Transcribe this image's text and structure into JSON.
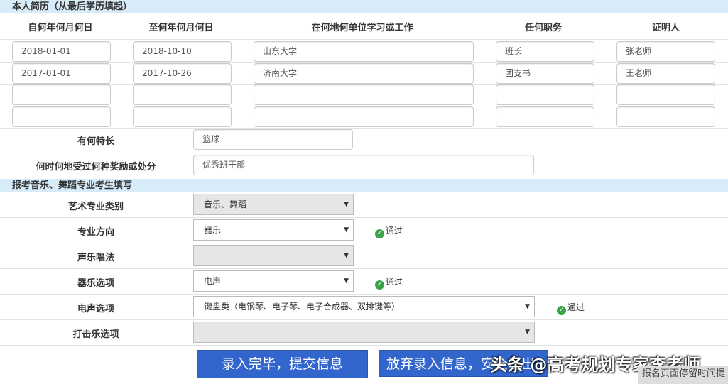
{
  "resume": {
    "title": "本人简历（从最后学历填起）",
    "columns": [
      "自何年何月何日",
      "至何年何月何日",
      "在何地何单位学习或工作",
      "任何职务",
      "证明人"
    ],
    "rows": [
      [
        "2018-01-01",
        "2018-10-10",
        "山东大学",
        "班长",
        "张老师"
      ],
      [
        "2017-01-01",
        "2017-10-26",
        "济南大学",
        "团支书",
        "王老师"
      ],
      [
        "",
        "",
        "",
        "",
        ""
      ],
      [
        "",
        "",
        "",
        "",
        ""
      ]
    ],
    "specialty_label": "有何特长",
    "specialty": "篮球",
    "awards_label": "何时何地受过何种奖励或处分",
    "awards": "优秀班干部"
  },
  "art": {
    "title": "报考音乐、舞蹈专业考生填写",
    "fields": [
      {
        "label": "艺术专业类别",
        "value": "音乐、舞蹈",
        "status": ""
      },
      {
        "label": "专业方向",
        "value": "器乐",
        "status": "通过"
      },
      {
        "label": "声乐唱法",
        "value": "",
        "status": ""
      },
      {
        "label": "器乐选项",
        "value": "电声",
        "status": "通过"
      },
      {
        "label": "电声选项",
        "value": "键盘类（电钢琴、电子琴、电子合成器、双排键等）",
        "status": "通过"
      },
      {
        "label": "打击乐选项",
        "value": "",
        "status": ""
      }
    ]
  },
  "buttons": {
    "submit": "录入完毕，提交信息",
    "cancel": "放弃录入信息，安全退出"
  },
  "watermark": {
    "text": "头条 @高考规划专家李老师",
    "overlay": "报名页面停留时间提"
  },
  "colors": {
    "section_bg": "#d7ebf9",
    "button": "#3366cc",
    "ok": "#3aa34a"
  }
}
